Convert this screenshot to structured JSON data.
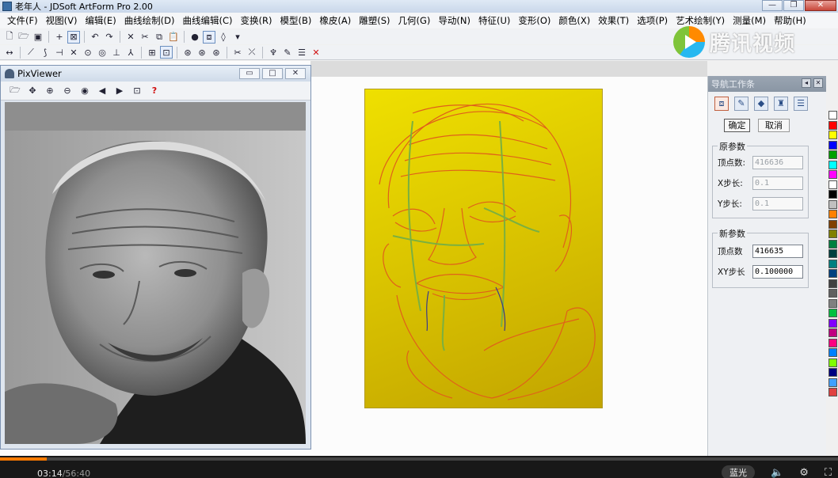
{
  "window": {
    "title": "老年人 - JDSoft ArtForm Pro 2.00"
  },
  "menu": [
    "文件(F)",
    "视图(V)",
    "编辑(E)",
    "曲线绘制(D)",
    "曲线编辑(C)",
    "变换(R)",
    "模型(B)",
    "橡皮(A)",
    "雕塑(S)",
    "几何(G)",
    "导动(N)",
    "特征(U)",
    "变形(O)",
    "颜色(X)",
    "效果(T)",
    "选项(P)",
    "艺术绘制(Y)",
    "测量(M)",
    "帮助(H)"
  ],
  "pixviewer": {
    "title": "PixViewer"
  },
  "nav_panel": {
    "title": "导航工作条",
    "confirm_label": "确定",
    "cancel_label": "取消",
    "original": {
      "legend": "原参数",
      "points_label": "顶点数:",
      "points_value": "416636",
      "xstep_label": "X步长:",
      "xstep_value": "0.1",
      "ystep_label": "Y步长:",
      "ystep_value": "0.1"
    },
    "new": {
      "legend": "新参数",
      "points_label": "顶点数",
      "points_value": "416635",
      "xystep_label": "XY步长",
      "xystep_value": "0.100000"
    }
  },
  "palette": [
    "#ffffff",
    "#ff0000",
    "#ffff00",
    "#0000ff",
    "#00a000",
    "#00ffff",
    "#ff00ff",
    "#ffffff",
    "#000000",
    "#c0c0c0",
    "#ff8000",
    "#804000",
    "#808000",
    "#008040",
    "#004040",
    "#008080",
    "#004080",
    "#404040",
    "#606060",
    "#808080",
    "#00c040",
    "#8000ff",
    "#c00080",
    "#ff0080",
    "#0080ff",
    "#80ff00",
    "#000080",
    "#40a0ff",
    "#e04040"
  ],
  "watermark": {
    "text": "腾讯视频"
  },
  "player": {
    "progress": 0.056,
    "current_time": "03:14",
    "total_time": "56:40",
    "quality_label": "蓝光"
  }
}
